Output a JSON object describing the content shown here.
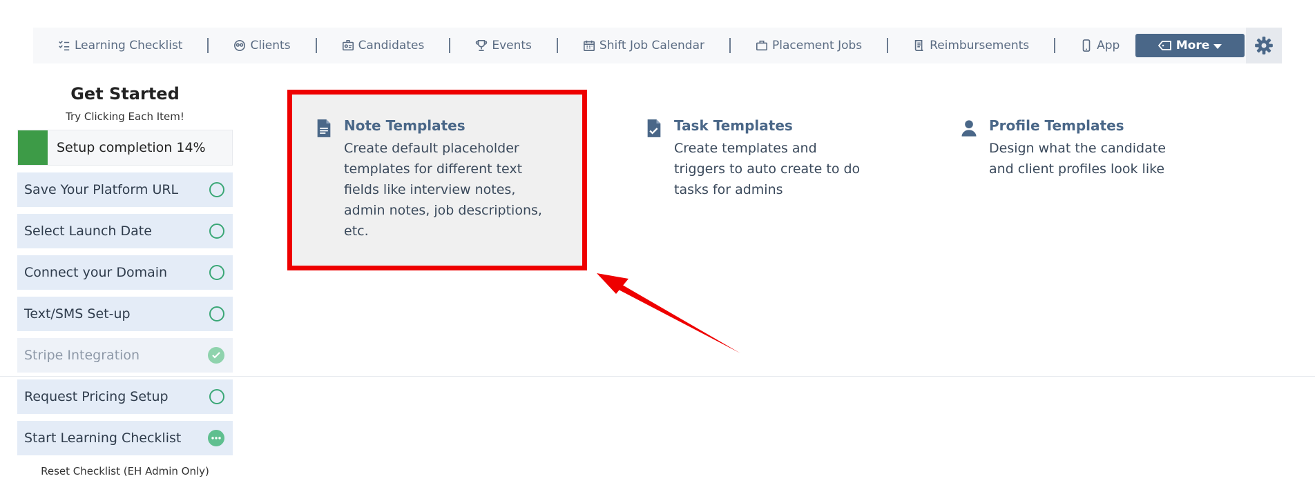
{
  "nav": {
    "items": [
      {
        "label": "Learning Checklist",
        "icon": "checklist-icon"
      },
      {
        "label": "Clients",
        "icon": "clients-icon"
      },
      {
        "label": "Candidates",
        "icon": "candidates-icon"
      },
      {
        "label": "Events",
        "icon": "trophy-icon"
      },
      {
        "label": "Shift Job Calendar",
        "icon": "calendar-icon"
      },
      {
        "label": "Placement Jobs",
        "icon": "briefcase-icon"
      },
      {
        "label": "Reimbursements",
        "icon": "receipt-icon"
      },
      {
        "label": "App",
        "icon": "phone-icon"
      }
    ],
    "more_label": "More",
    "settings_icon": "gear-icon"
  },
  "sidebar": {
    "title": "Get Started",
    "subtitle": "Try Clicking Each Item!",
    "progress_label": "Setup completion 14%",
    "progress_value": 0.14,
    "items": [
      {
        "label": "Save Your Platform URL",
        "status": "pending"
      },
      {
        "label": "Select Launch Date",
        "status": "pending"
      },
      {
        "label": "Connect your Domain",
        "status": "pending"
      },
      {
        "label": "Text/SMS Set-up",
        "status": "pending"
      },
      {
        "label": "Stripe Integration",
        "status": "done"
      },
      {
        "label": "Request Pricing Setup",
        "status": "pending"
      },
      {
        "label": "Start Learning Checklist",
        "status": "in-progress"
      }
    ],
    "reset_label": "Reset Checklist (EH Admin Only)"
  },
  "templates": {
    "note": {
      "title": "Note Templates",
      "lines": [
        "Create default placeholder",
        "templates for different text",
        "fields like interview notes,",
        "admin notes, job descriptions,",
        "etc."
      ]
    },
    "task": {
      "title": "Task Templates",
      "lines": [
        "Create templates and",
        "triggers to auto create to do",
        "tasks for admins"
      ]
    },
    "profile": {
      "title": "Profile Templates",
      "lines": [
        "Design what the candidate",
        "and client profiles look like"
      ]
    }
  },
  "colors": {
    "accent": "#4a6788",
    "progress_green": "#3d9b47",
    "status_green": "#3aa776",
    "highlight_red": "#ee0000"
  }
}
